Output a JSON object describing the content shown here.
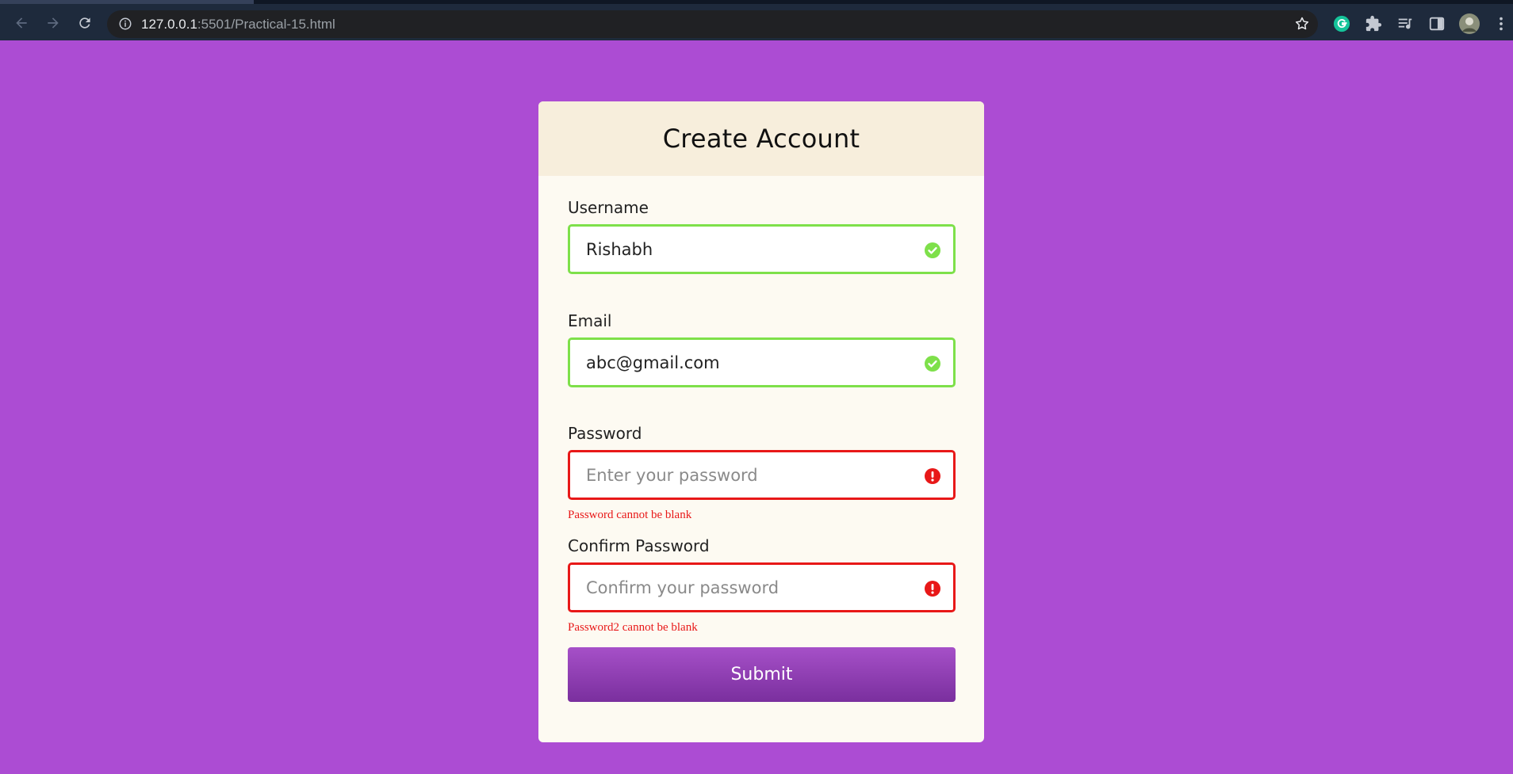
{
  "browser": {
    "url_host": "127.0.0.1",
    "url_rest": ":5501/Practical-15.html"
  },
  "form": {
    "title": "Create Account",
    "username": {
      "label": "Username",
      "value": "Rishabh",
      "state": "success"
    },
    "email": {
      "label": "Email",
      "value": "abc@gmail.com",
      "state": "success"
    },
    "password": {
      "label": "Password",
      "value": "",
      "placeholder": "Enter your password",
      "state": "error",
      "error": "Password cannot be blank"
    },
    "password2": {
      "label": "Confirm Password",
      "value": "",
      "placeholder": "Confirm your password",
      "state": "error",
      "error": "Password2 cannot be blank"
    },
    "submit_label": "Submit"
  },
  "colors": {
    "background": "#ac4cd3",
    "success": "#7ee04a",
    "error": "#e81818",
    "button_top": "#a650c8",
    "button_bottom": "#7a2f9e"
  },
  "icons": {
    "success": "check-circle-icon",
    "error": "exclamation-circle-icon"
  }
}
